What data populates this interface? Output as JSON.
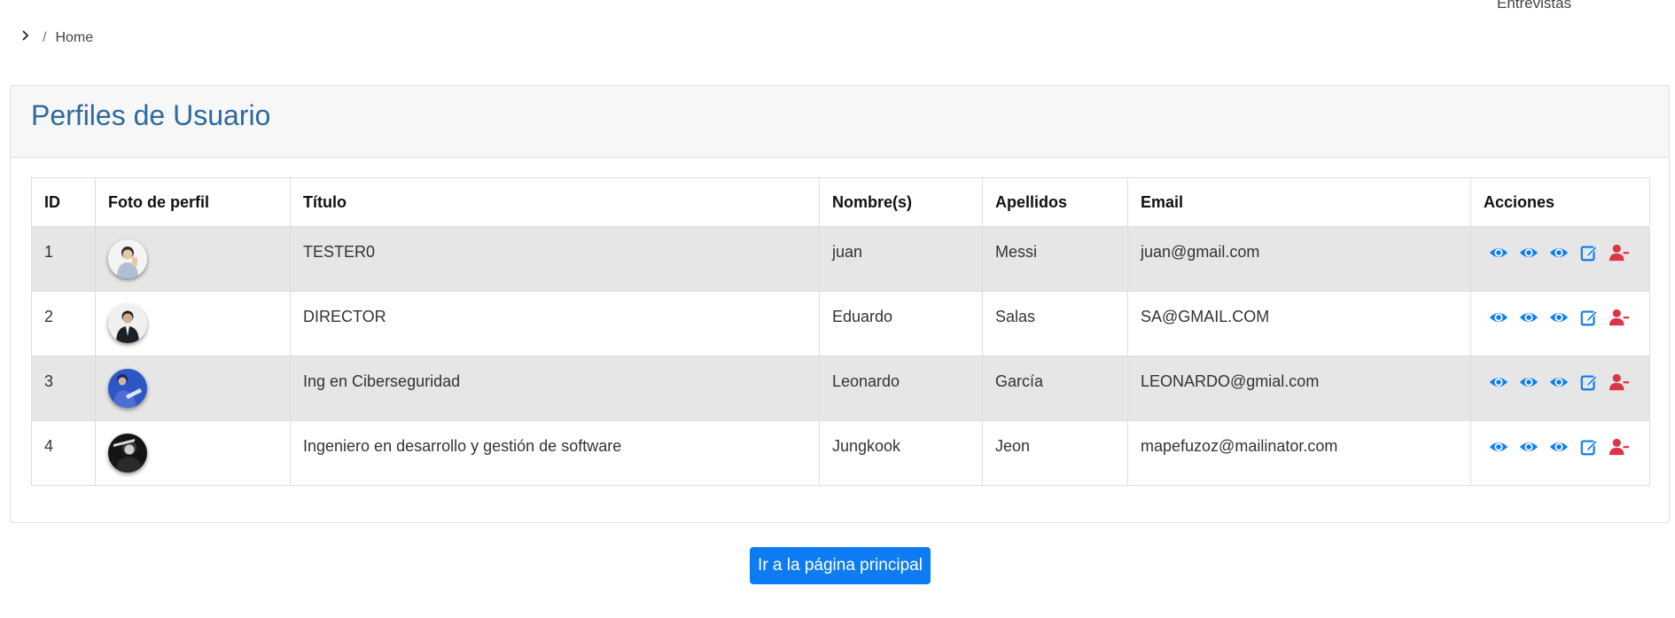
{
  "top_nav": {
    "label": "Entrevistas"
  },
  "breadcrumb": {
    "separator": "/",
    "home": "Home"
  },
  "card": {
    "title": "Perfiles de Usuario"
  },
  "table": {
    "headers": [
      "ID",
      "Foto de perfil",
      "Título",
      "Nombre(s)",
      "Apellidos",
      "Email",
      "Acciones"
    ],
    "rows": [
      {
        "id": "1",
        "titulo": "TESTER0",
        "nombre": "juan",
        "apellidos": "Messi",
        "email": "juan@gmail.com"
      },
      {
        "id": "2",
        "titulo": "DIRECTOR",
        "nombre": "Eduardo",
        "apellidos": "Salas",
        "email": "SA@GMAIL.COM"
      },
      {
        "id": "3",
        "titulo": "Ing en Ciberseguridad",
        "nombre": "Leonardo",
        "apellidos": "García",
        "email": "LEONARDO@gmial.com"
      },
      {
        "id": "4",
        "titulo": "Ingeniero en desarrollo y gestión de software",
        "nombre": "Jungkook",
        "apellidos": "Jeon",
        "email": "mapefuzoz@mailinator.com"
      }
    ],
    "actions": [
      "eye-icon",
      "eye-icon",
      "eye-icon",
      "edit-icon",
      "user-minus-icon"
    ]
  },
  "footer": {
    "button_label": "Ir a la página principal"
  },
  "colors": {
    "accent": "#0d7cf2",
    "title": "#2c6aa0",
    "danger": "#dc3545"
  }
}
